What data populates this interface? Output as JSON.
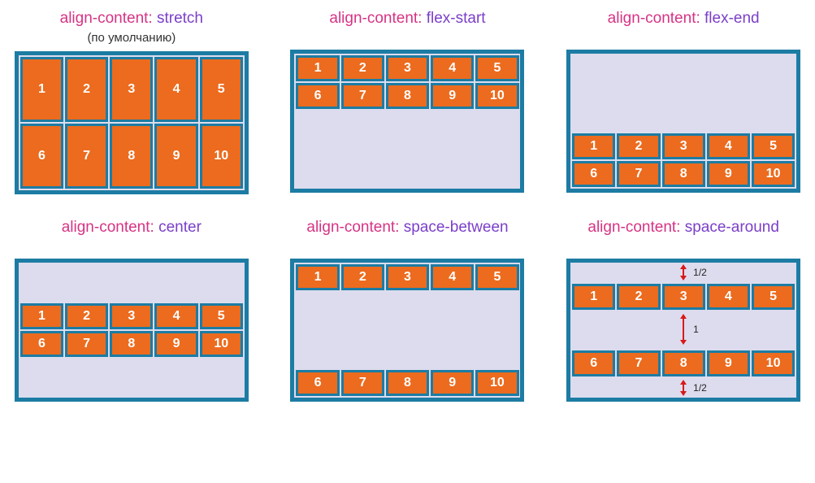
{
  "property": "align-content",
  "default_note": "(по умолчанию)",
  "examples": [
    {
      "value": "stretch",
      "is_default": true
    },
    {
      "value": "flex-start",
      "is_default": false
    },
    {
      "value": "flex-end",
      "is_default": false
    },
    {
      "value": "center",
      "is_default": false
    },
    {
      "value": "space-between",
      "is_default": false
    },
    {
      "value": "space-around",
      "is_default": false,
      "annotations": [
        {
          "pos": "top",
          "label": "1/2"
        },
        {
          "pos": "mid",
          "label": "1"
        },
        {
          "pos": "bot",
          "label": "1/2"
        }
      ]
    }
  ],
  "items": [
    "1",
    "2",
    "3",
    "4",
    "5",
    "6",
    "7",
    "8",
    "9",
    "10"
  ],
  "colors": {
    "border": "#1c7ca3",
    "item_bg": "#ec6b1e",
    "container_bg": "#dcdcee",
    "prop": "#d63384",
    "val": "#7b3fc9",
    "arrow": "#d91818"
  }
}
